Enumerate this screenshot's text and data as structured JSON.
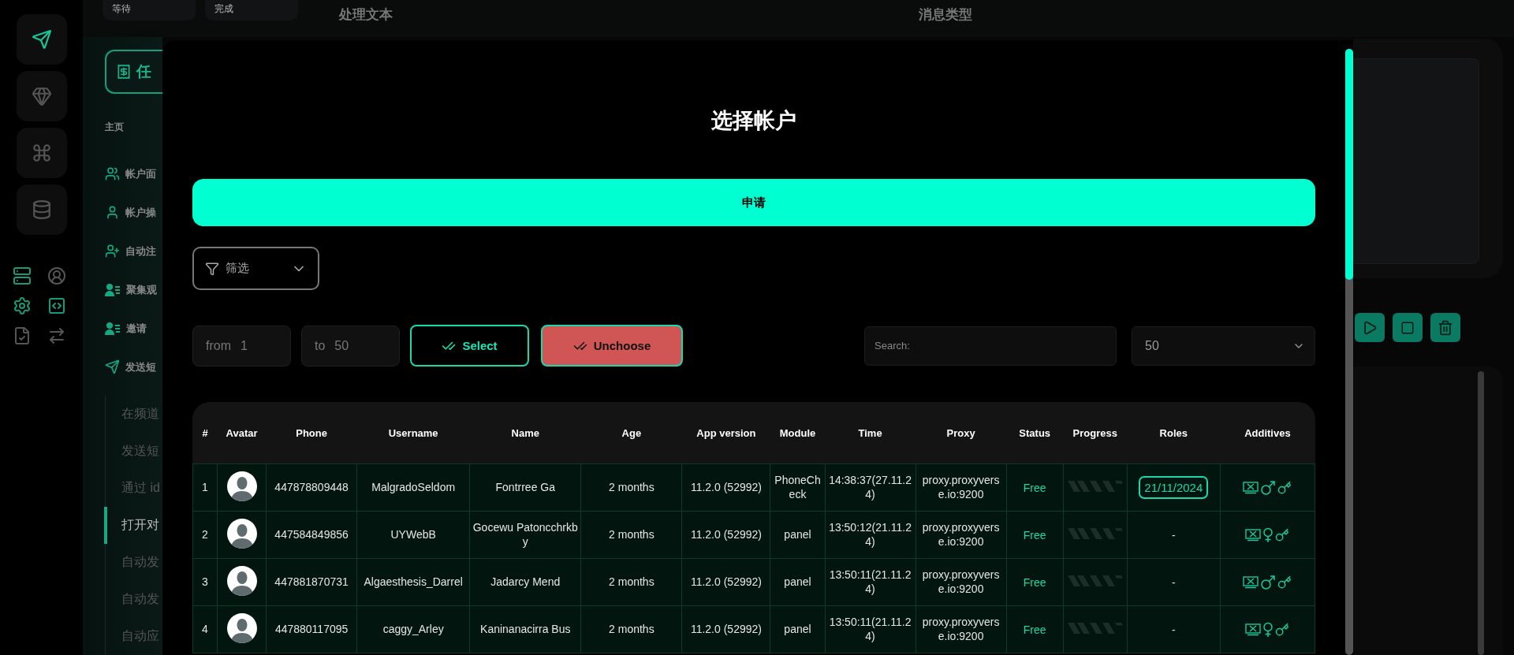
{
  "rail": {
    "items": [
      {
        "selected": true
      },
      {
        "selected": false
      },
      {
        "selected": false
      },
      {
        "selected": false
      }
    ],
    "tools": [
      {
        "active": true
      },
      {
        "active": false
      },
      {
        "active": true
      },
      {
        "active": true
      },
      {
        "active": false
      },
      {
        "active": false
      }
    ]
  },
  "top_bar": {
    "statuses": [
      "等待",
      "完成"
    ],
    "headings": [
      "处理文本",
      "消息类型"
    ]
  },
  "sidebar": {
    "task_button": "任",
    "section": "主页",
    "items": [
      {
        "label": "帐户面"
      },
      {
        "label": "帐户操"
      },
      {
        "label": "自动注"
      },
      {
        "label": "聚集观"
      },
      {
        "label": "邀请"
      },
      {
        "label": "发送短",
        "children": [
          {
            "label": "在频道",
            "selected": false
          },
          {
            "label": "发送短",
            "selected": false
          },
          {
            "label": "通过 id",
            "selected": false
          },
          {
            "label": "打开对",
            "selected": true
          },
          {
            "label": "自动发",
            "selected": false
          },
          {
            "label": "自动发",
            "selected": false
          },
          {
            "label": "自动应",
            "selected": false
          }
        ]
      }
    ]
  },
  "modal": {
    "title": "选择帐户",
    "apply_button": "申请",
    "filter": {
      "label": "筛选"
    },
    "range": {
      "from_label": "from",
      "from_value": "1",
      "to_label": "to",
      "to_value": "50"
    },
    "select_button": "Select",
    "unchoose_button": "Unchoose",
    "search": {
      "placeholder": "Search:"
    },
    "page_size": "50",
    "table": {
      "columns": [
        "#",
        "Avatar",
        "Phone",
        "Username",
        "Name",
        "Age",
        "App version",
        "Module",
        "Time",
        "Proxy",
        "Status",
        "Progress",
        "Roles",
        "Additives"
      ],
      "rows": [
        {
          "index": "1",
          "phone": "447878809448",
          "username": "MalgradoSeldom",
          "name": "Fontrree Ga",
          "age": "2 months",
          "app_version": "11.2.0 (52992)",
          "module": "PhoneCheck",
          "time": "14:38:37(27.11.24)",
          "proxy": "proxy.proxyverse.io:9200",
          "status": "Free",
          "roles": {
            "kind": "badge",
            "text": "21/11/2024"
          },
          "male": true
        },
        {
          "index": "2",
          "phone": "447584849856",
          "username": "UYWebB",
          "name": "Gocewu Patoncchrkby",
          "age": "2 months",
          "app_version": "11.2.0 (52992)",
          "module": "panel",
          "time": "13:50:12(21.11.24)",
          "proxy": "proxy.proxyverse.io:9200",
          "status": "Free",
          "roles": {
            "kind": "text",
            "text": "-"
          },
          "male": false
        },
        {
          "index": "3",
          "phone": "447881870731",
          "username": "Algaesthesis_Darrel",
          "name": "Jadarcy Mend",
          "age": "2 months",
          "app_version": "11.2.0 (52992)",
          "module": "panel",
          "time": "13:50:11(21.11.24)",
          "proxy": "proxy.proxyverse.io:9200",
          "status": "Free",
          "roles": {
            "kind": "text",
            "text": "-"
          },
          "male": true
        },
        {
          "index": "4",
          "phone": "447880117095",
          "username": "caggy_Arley",
          "name": "Kaninanacirra Bus",
          "age": "2 months",
          "app_version": "11.2.0 (52992)",
          "module": "panel",
          "time": "13:50:11(21.11.24)",
          "proxy": "proxy.proxyverse.io:9200",
          "status": "Free",
          "roles": {
            "kind": "text",
            "text": "-"
          },
          "male": false
        }
      ]
    }
  }
}
